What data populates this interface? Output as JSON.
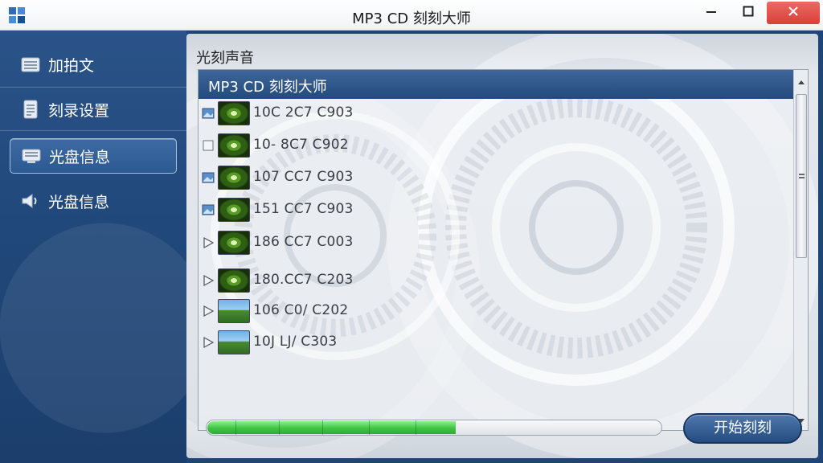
{
  "window": {
    "title": "MP3 CD 刻刻大师",
    "icons": {
      "app": "app-logo-icon",
      "minimize": "minimize-icon",
      "maximize": "maximize-icon",
      "close": "close-icon"
    }
  },
  "sidebar": {
    "items": [
      {
        "label": "加拍文",
        "icon": "folder-stack-icon",
        "active": false
      },
      {
        "label": "刻录设置",
        "icon": "document-icon",
        "active": false
      },
      {
        "label": "光盘信息",
        "icon": "disc-drive-icon",
        "active": true
      },
      {
        "label": "光盘信息",
        "icon": "speaker-icon",
        "active": false
      }
    ]
  },
  "main": {
    "section_title": "光刻声音",
    "list_header": "MP3 CD 刻刻大师",
    "items": [
      {
        "name": "10C 2C7 C903",
        "marker": "image-icon",
        "thumb": "green"
      },
      {
        "name": "10- 8C7 C902",
        "marker": "checkbox",
        "thumb": "green"
      },
      {
        "name": "107 CC7 C903",
        "marker": "image-icon",
        "thumb": "green"
      },
      {
        "name": "151 CC7 C903",
        "marker": "image-icon",
        "thumb": "green"
      },
      {
        "name": "186 CC7 C003",
        "marker": "play-icon",
        "thumb": "green"
      },
      {
        "name": "180.CC7 C203",
        "marker": "play-icon",
        "thumb": "green"
      },
      {
        "name": "106 C0/ C202",
        "marker": "play-icon",
        "thumb": "landscape"
      },
      {
        "name": "10J LJ/ C303",
        "marker": "play-icon",
        "thumb": "landscape"
      }
    ],
    "progress_percent": 55,
    "start_button": "开始刻刻"
  },
  "colors": {
    "sidebar": "#21487a",
    "header": "#2e5588",
    "progress": "#3ec443",
    "close": "#e0524b"
  }
}
